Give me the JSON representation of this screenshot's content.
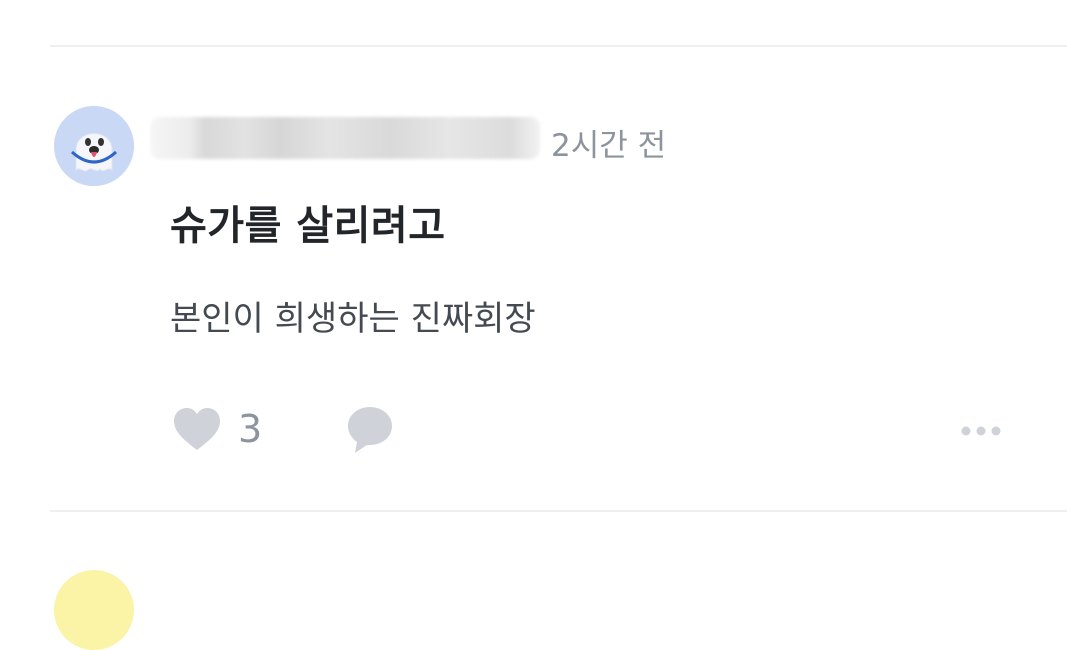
{
  "comment": {
    "avatar_icon": "ghost-character-avatar",
    "username": "",
    "timestamp": "2시간 전",
    "title": "슈가를 살리려고",
    "body": "본인이 희생하는 진짜회장",
    "actions": {
      "like_icon": "heart-icon",
      "like_count": "3",
      "comment_icon": "speech-bubble-icon",
      "more_icon": "more-dots-icon"
    }
  },
  "colors": {
    "background": "#ffffff",
    "divider": "#eeeff1",
    "title_text": "#222529",
    "body_text": "#454a52",
    "muted_text": "#8e949e",
    "icon_gray": "#cfd3d9",
    "avatar_bg": "#c9d9f5",
    "next_avatar_bg": "#fbf3a6"
  }
}
